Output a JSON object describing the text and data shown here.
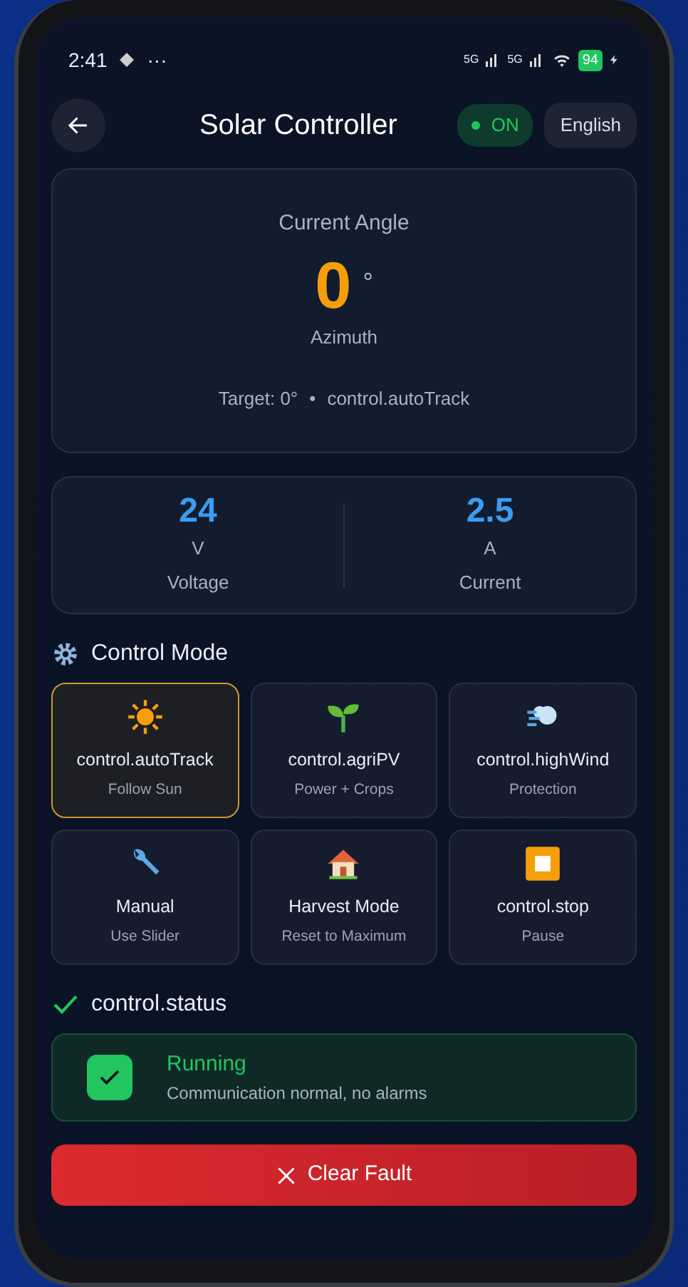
{
  "status_bar": {
    "time": "2:41",
    "more": "···",
    "network_1": "5G",
    "network_2": "5G",
    "battery": "94"
  },
  "header": {
    "title": "Solar Controller",
    "power": {
      "label": "ON",
      "on": true
    },
    "language": "English"
  },
  "angle": {
    "title": "Current Angle",
    "value": "0",
    "unit": "°",
    "axis": "Azimuth",
    "target": "Target: 0°",
    "separator": "•",
    "mode": "control.autoTrack"
  },
  "metrics": [
    {
      "value": "24",
      "unit": "V",
      "label": "Voltage"
    },
    {
      "value": "2.5",
      "unit": "A",
      "label": "Current"
    }
  ],
  "control_mode": {
    "title": "Control Mode",
    "modes": [
      {
        "kind": "sun",
        "label": "control.autoTrack",
        "sub": "Follow Sun",
        "selected": true
      },
      {
        "kind": "sprout",
        "label": "control.agriPV",
        "sub": "Power + Crops",
        "selected": false
      },
      {
        "kind": "wind",
        "label": "control.highWind",
        "sub": "Protection",
        "selected": false
      },
      {
        "kind": "wrench",
        "label": "Manual",
        "sub": "Use Slider",
        "selected": false
      },
      {
        "kind": "house",
        "label": "Harvest Mode",
        "sub": "Reset to Maximum",
        "selected": false
      },
      {
        "kind": "stop",
        "label": "control.stop",
        "sub": "Pause",
        "selected": false
      }
    ]
  },
  "status": {
    "title": "control.status",
    "state": "Running",
    "ok": true,
    "message": "Communication normal, no alarms"
  },
  "action": "Clear Fault"
}
